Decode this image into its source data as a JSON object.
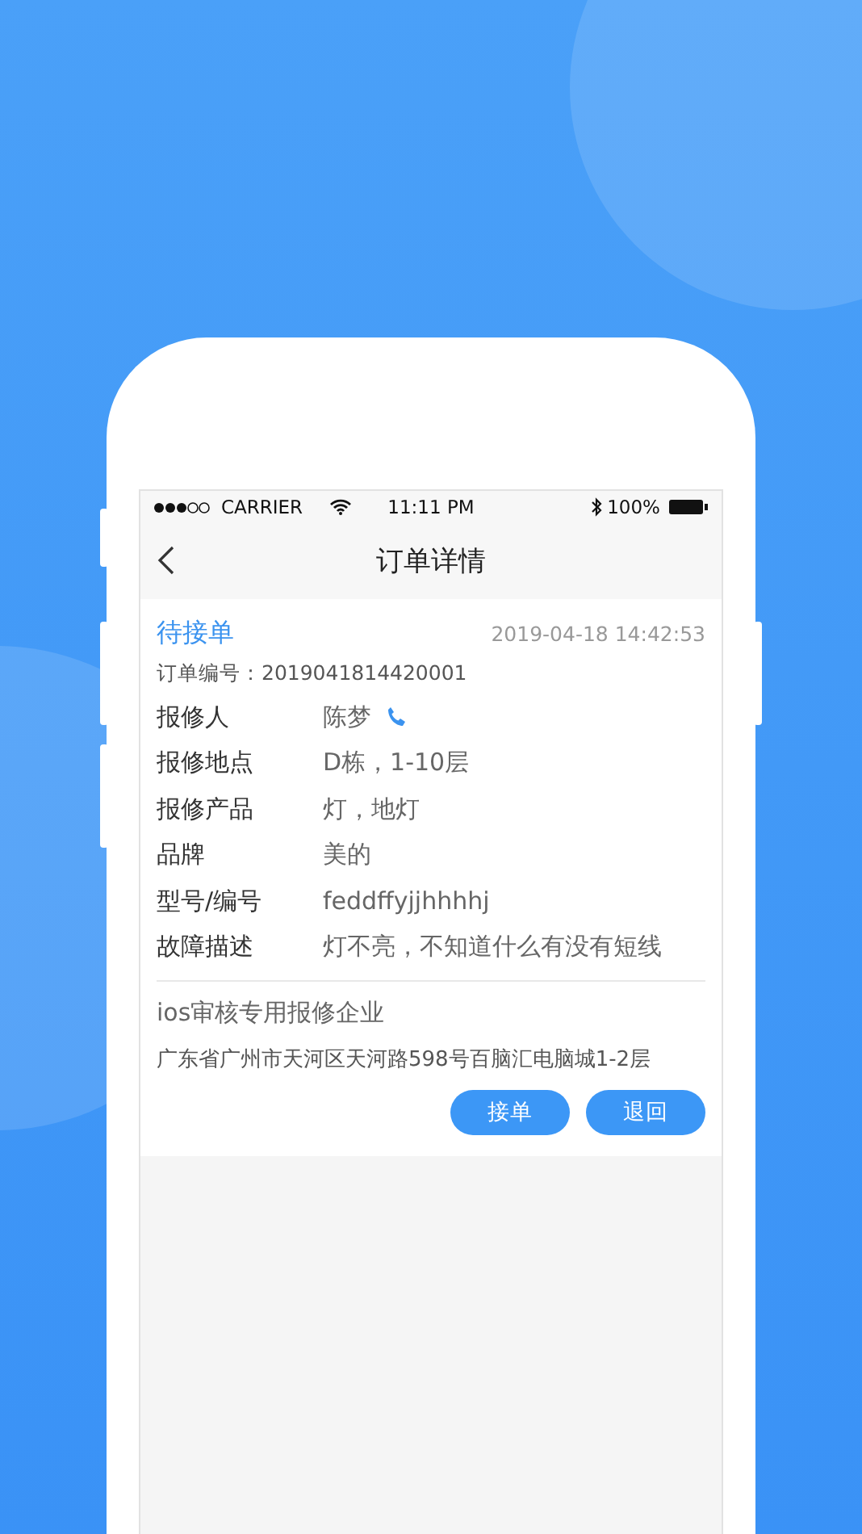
{
  "status_bar": {
    "carrier": "CARRIER",
    "time": "11:11 PM",
    "battery": "100%"
  },
  "nav": {
    "title": "订单详情"
  },
  "order": {
    "status": "待接单",
    "time": "2019-04-18 14:42:53",
    "number_label": "订单编号：",
    "number": "2019041814420001",
    "fields": [
      {
        "label": "报修人",
        "value": "陈梦",
        "phone": true
      },
      {
        "label": "报修地点",
        "value": "D栋，1-10层",
        "phone": false
      },
      {
        "label": "报修产品",
        "value": "灯，地灯",
        "phone": false
      },
      {
        "label": "品牌",
        "value": "美的",
        "phone": false
      },
      {
        "label": "型号/编号",
        "value": "feddffyjjhhhhj",
        "phone": false
      },
      {
        "label": "故障描述",
        "value": "灯不亮，不知道什么有没有短线",
        "phone": false
      }
    ],
    "company": "ios审核专用报修企业",
    "address": "广东省广州市天河区天河路598号百脑汇电脑城1-2层",
    "buttons": [
      "接单",
      "退回"
    ]
  }
}
